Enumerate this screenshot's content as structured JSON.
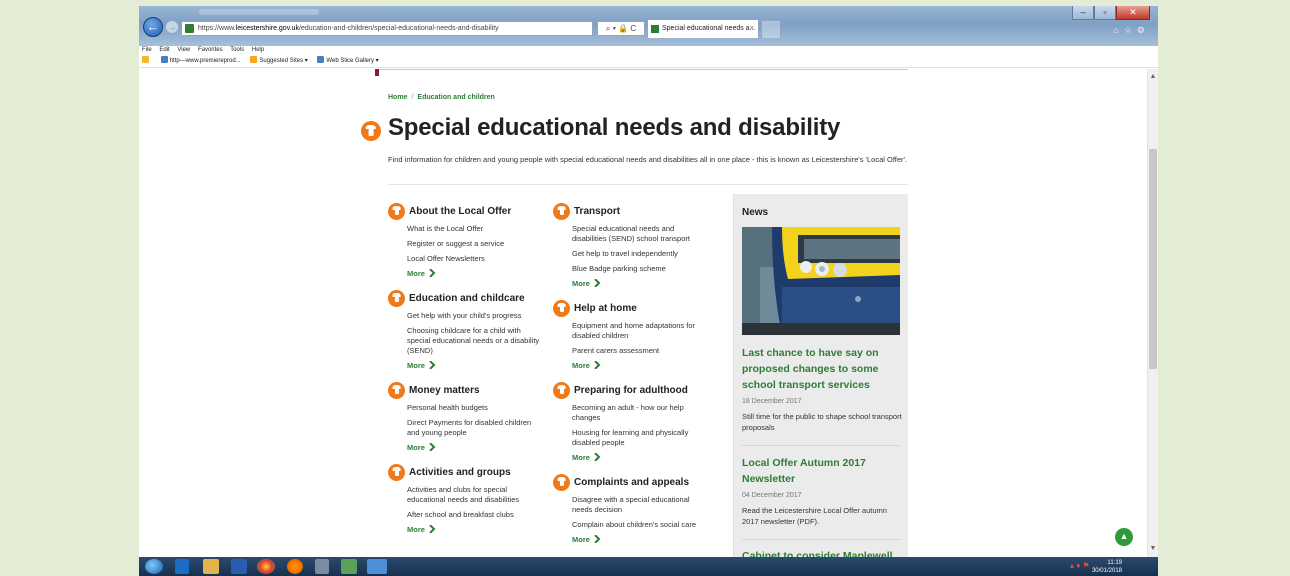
{
  "browser": {
    "url_prefix": "https://www.",
    "url_domain": "leicestershire.gov.uk",
    "url_path": "/education-and-children/special-educational-needs-and-disability",
    "addr_tools": "⌕ ▾ 🔒 C",
    "tab_title": "Special educational needs a...",
    "tab_close": "×",
    "menu": [
      "File",
      "Edit",
      "View",
      "Favorites",
      "Tools",
      "Help"
    ],
    "favorites": [
      "http---www.premiereprod...",
      "Suggested Sites ▾",
      "Web Slice Gallery ▾"
    ]
  },
  "breadcrumb": {
    "home": "Home",
    "sep": "/",
    "current": "Education and children"
  },
  "page": {
    "title": "Special educational needs and disability",
    "intro": "Find information for children and young people with special educational needs and disabilities all in one place - this is known as Leicestershire's 'Local Offer'."
  },
  "more_label": "More",
  "columns": [
    [
      {
        "title": "About the Local Offer",
        "links": [
          "What is the Local Offer",
          "Register or suggest a service",
          "Local Offer Newsletters"
        ]
      },
      {
        "title": "Education and childcare",
        "links": [
          "Get help with your child's progress",
          "Choosing childcare for a child with special educational needs or a disability (SEND)"
        ]
      },
      {
        "title": "Money matters",
        "links": [
          "Personal health budgets",
          "Direct Payments for disabled children and young people"
        ]
      },
      {
        "title": "Activities and groups",
        "links": [
          "Activities and clubs for special educational needs and disabilities",
          "After school and breakfast clubs"
        ]
      }
    ],
    [
      {
        "title": "Transport",
        "links": [
          "Special educational needs and disabilities (SEND) school transport",
          "Get help to travel independently",
          "Blue Badge parking scheme"
        ]
      },
      {
        "title": "Help at home",
        "links": [
          "Equipment and home adaptations for disabled children",
          "Parent carers assessment"
        ]
      },
      {
        "title": "Preparing for adulthood",
        "links": [
          "Becoming an adult - how our help changes",
          "Housing for learning and physically disabled people"
        ]
      },
      {
        "title": "Complaints and appeals",
        "links": [
          "Disagree with a special educational needs decision",
          "Complain about children's social care"
        ]
      }
    ]
  ],
  "news": {
    "heading": "News",
    "items": [
      {
        "title": "Last chance to have say on proposed changes to some school transport services",
        "date": "18 December 2017",
        "desc": "Still time for the public to shape school transport proposals"
      },
      {
        "title": "Local Offer Autumn 2017 Newsletter",
        "date": "04 December 2017",
        "desc": "Read the Leicestershire Local Offer autumn 2017 newsletter (PDF)."
      },
      {
        "title": "Cabinet to consider Maplewell Hall"
      }
    ]
  },
  "tray": {
    "time": "11:19",
    "date": "30/01/2018"
  },
  "colors": {
    "green": "#2f7d34",
    "orange": "#f07a1a",
    "news_bg": "#ebebeb"
  },
  "icons": [
    "back-icon",
    "forward-icon",
    "search-icon",
    "lock-icon",
    "refresh-icon",
    "home-icon",
    "star-icon",
    "gear-icon",
    "chevron-right-icon",
    "chevron-up-icon"
  ]
}
